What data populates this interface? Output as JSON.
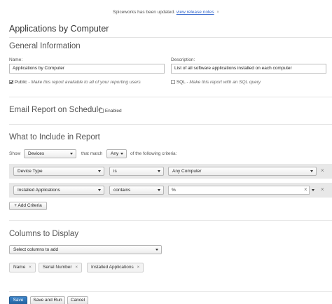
{
  "notice": {
    "text": "Spiceworks has been updated.",
    "link": "view release notes",
    "close": "×"
  },
  "page_title": "Applications by Computer",
  "general": {
    "heading": "General Information",
    "name_label": "Name:",
    "name_value": "Applications by Computer",
    "description_label": "Description:",
    "description_value": "List of all software applications installed on each computer",
    "public_label": "Public",
    "public_hint": "- Make this report available to all of your reporting users",
    "public_checked": true,
    "sql_label": "SQL",
    "sql_hint": "- Make this report with an SQL query",
    "sql_checked": false
  },
  "email": {
    "heading": "Email Report on Schedule",
    "enabled_label": "Enabled",
    "enabled_checked": false
  },
  "include": {
    "heading": "What to Include in Report",
    "show_label": "Show",
    "show_value": "Devices",
    "match_label": "that match",
    "match_value": "Any",
    "criteria_suffix": "of the following criteria:",
    "criteria": [
      {
        "field": "Device Type",
        "operator": "is",
        "value": "Any Computer",
        "remove": "×"
      },
      {
        "field": "Installed Applications",
        "operator": "contains",
        "value": "%",
        "clear": "×",
        "remove": "×"
      }
    ],
    "add_criteria": "Add Criteria"
  },
  "columns": {
    "heading": "Columns to Display",
    "select_placeholder": "Select columns to add",
    "tags": [
      {
        "label": "Name",
        "x": "×"
      },
      {
        "label": "Serial Number",
        "x": "×"
      },
      {
        "label": "Installed Applications",
        "x": "×"
      }
    ]
  },
  "buttons": {
    "save": "Save",
    "save_run": "Save and Run",
    "cancel": "Cancel"
  }
}
